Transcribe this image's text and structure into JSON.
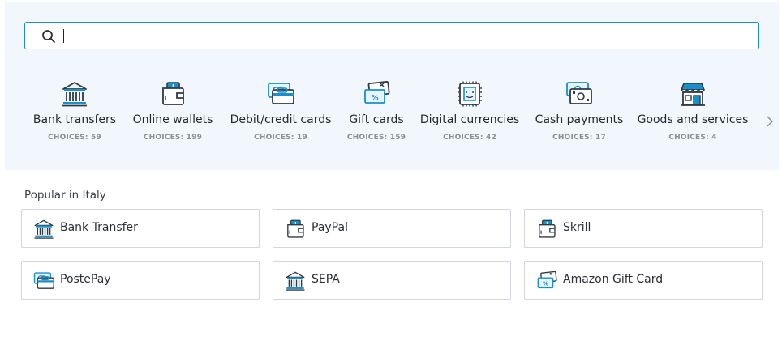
{
  "search": {
    "placeholder": "",
    "value": ""
  },
  "categories": [
    {
      "label": "Bank transfers",
      "count": "CHOICES: 59",
      "icon": "bank-icon"
    },
    {
      "label": "Online wallets",
      "count": "CHOICES: 199",
      "icon": "wallet-icon"
    },
    {
      "label": "Debit/credit cards",
      "count": "CHOICES: 19",
      "icon": "card-icon"
    },
    {
      "label": "Gift cards",
      "count": "CHOICES: 159",
      "icon": "gift-card-icon"
    },
    {
      "label": "Digital currencies",
      "count": "CHOICES: 42",
      "icon": "chip-icon"
    },
    {
      "label": "Cash payments",
      "count": "CHOICES: 17",
      "icon": "cash-icon"
    },
    {
      "label": "Goods and services",
      "count": "CHOICES: 4",
      "icon": "store-icon"
    }
  ],
  "popular": {
    "title": "Popular in Italy",
    "items": [
      {
        "label": "Bank Transfer",
        "icon": "bank-icon"
      },
      {
        "label": "PayPal",
        "icon": "wallet-icon"
      },
      {
        "label": "Skrill",
        "icon": "wallet-icon"
      },
      {
        "label": "PostePay",
        "icon": "card-icon"
      },
      {
        "label": "SEPA",
        "icon": "bank-icon"
      },
      {
        "label": "Amazon Gift Card",
        "icon": "gift-card-icon"
      }
    ]
  },
  "colors": {
    "accent": "#1a8fc9",
    "icon_dark": "#2f3a44",
    "panel_bg": "#f1f7fc"
  }
}
